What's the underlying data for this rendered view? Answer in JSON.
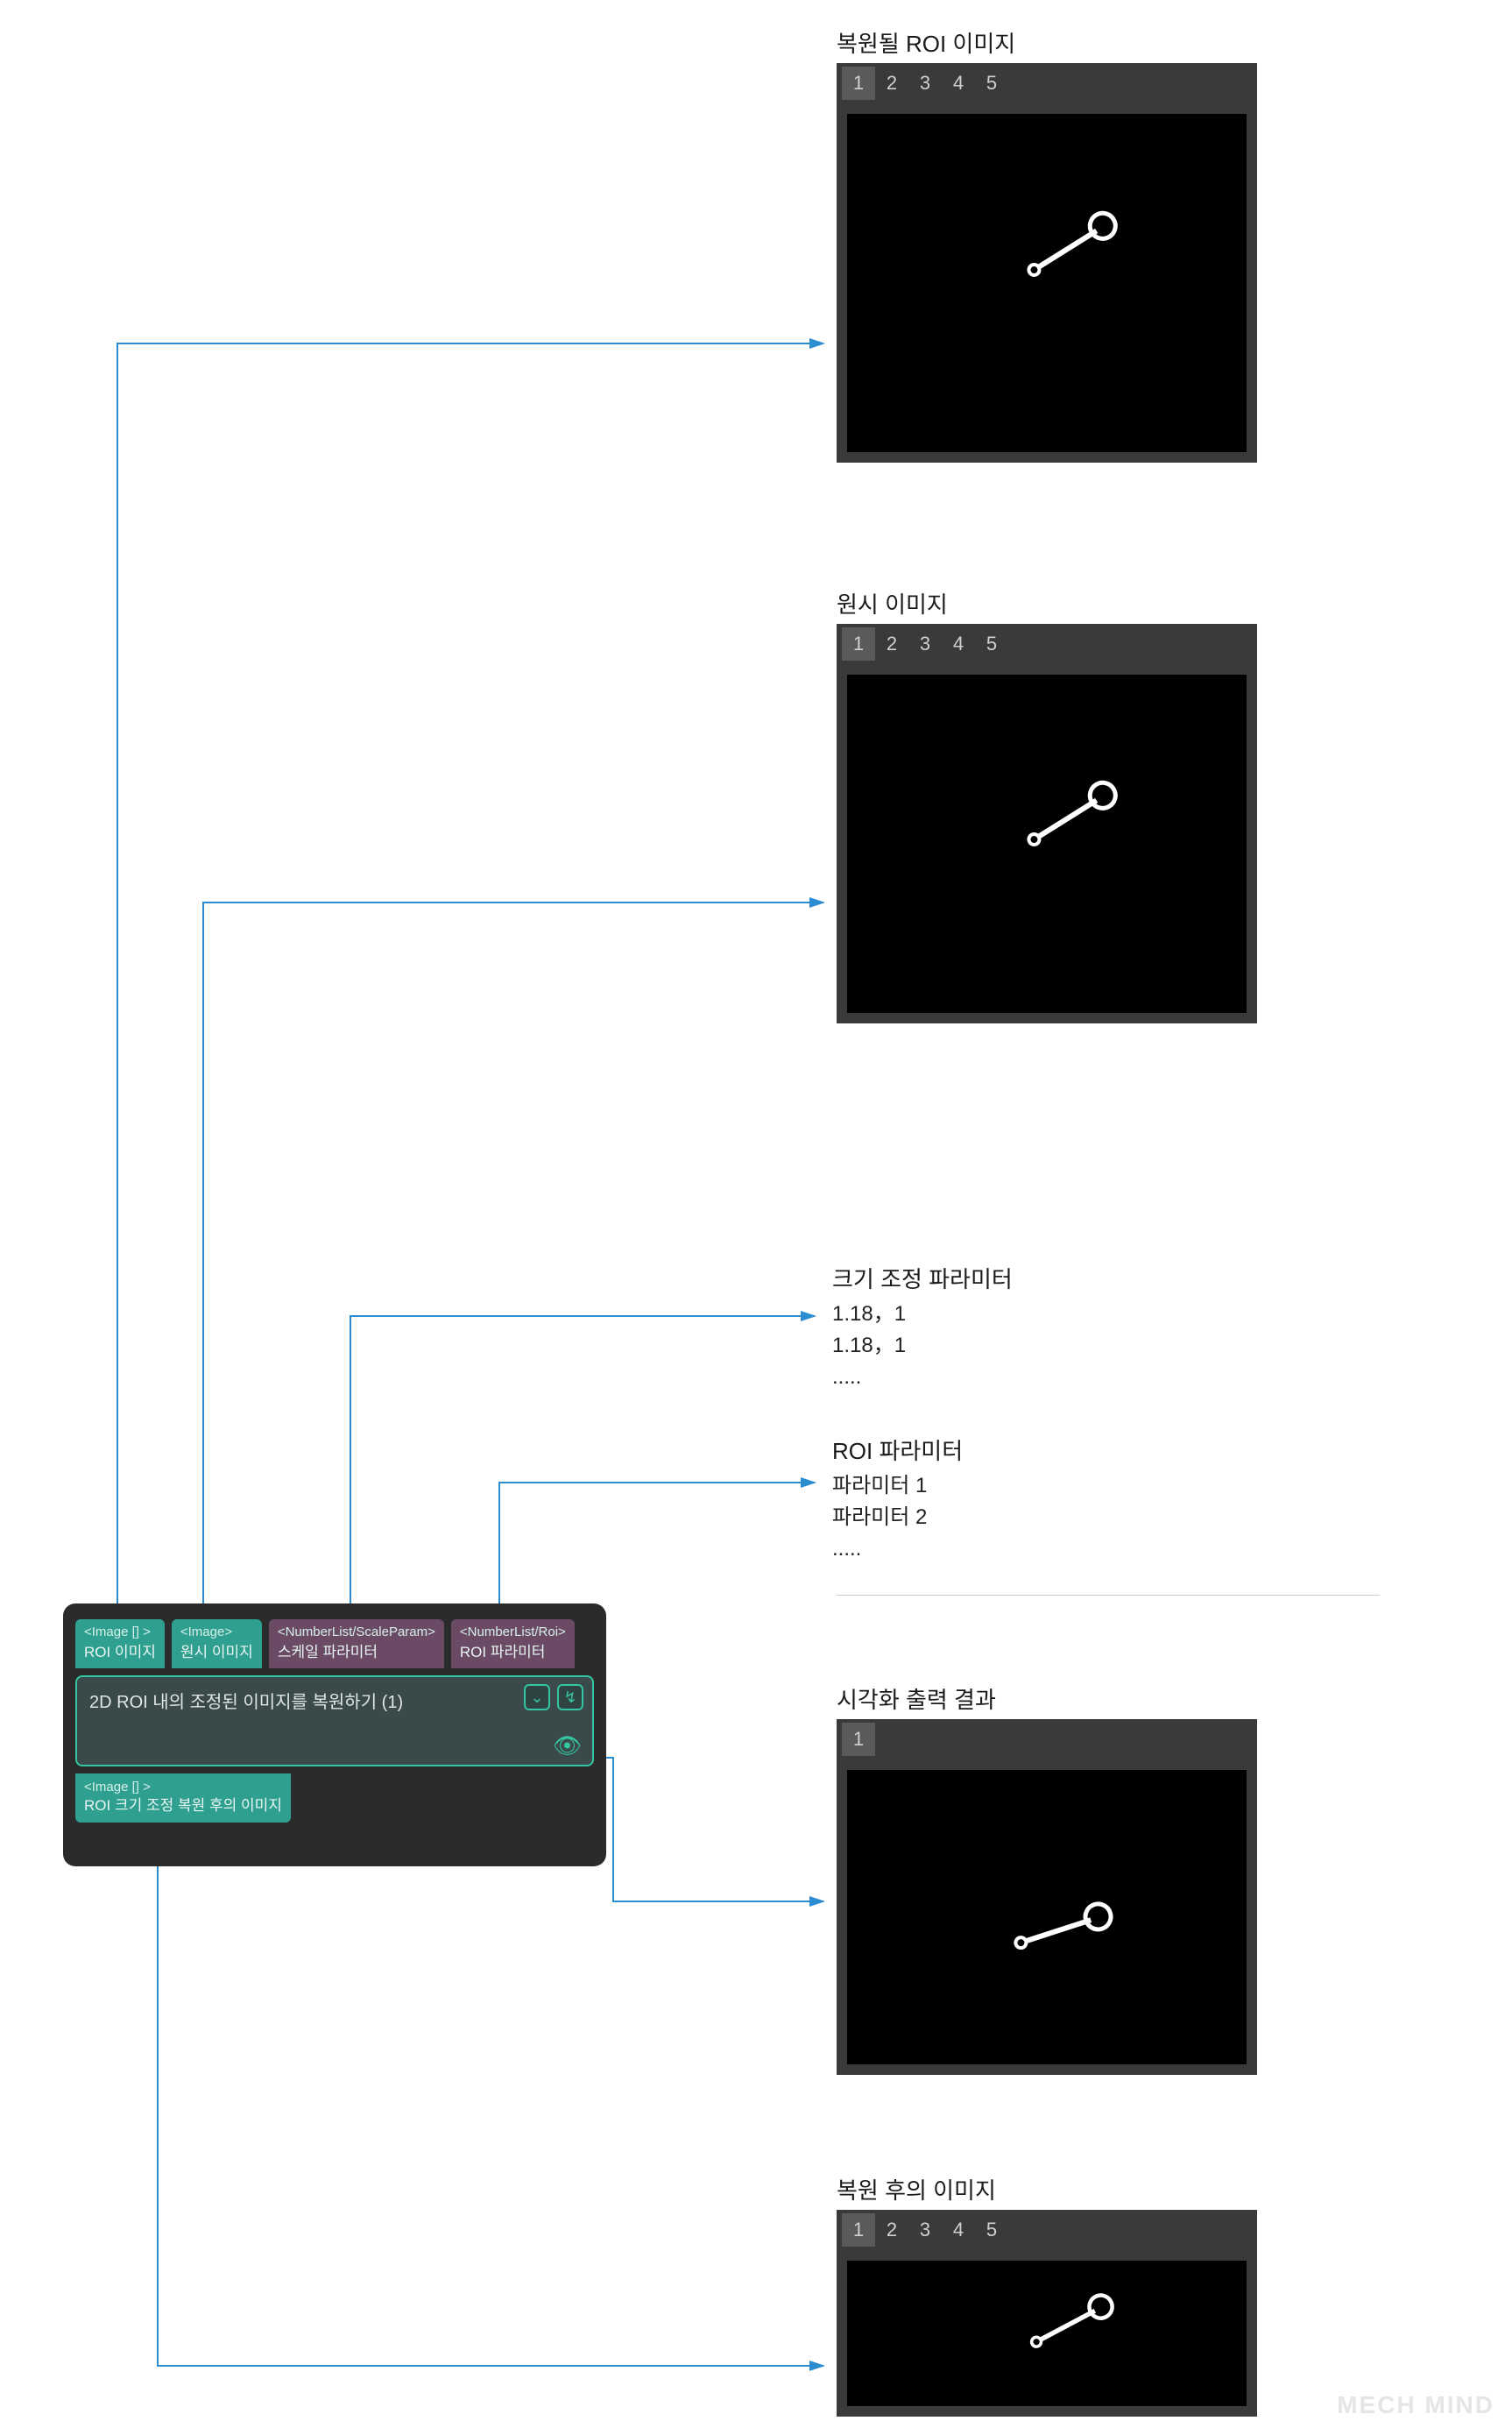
{
  "panels": {
    "roi_restore": {
      "title": "복원될 ROI 이미지",
      "tabs": [
        "1",
        "2",
        "3",
        "4",
        "5"
      ],
      "active_tab": 0
    },
    "raw_image": {
      "title": "원시 이미지",
      "tabs": [
        "1",
        "2",
        "3",
        "4",
        "5"
      ],
      "active_tab": 0
    },
    "scale_params": {
      "title": "크기 조정 파라미터",
      "lines": [
        "1.18，1",
        "1.18，1",
        "....."
      ]
    },
    "roi_params": {
      "title": "ROI 파라미터",
      "lines": [
        "파라미터 1",
        "파라미터 2",
        "....."
      ]
    },
    "viz_output": {
      "title": "시각화 출력 결과",
      "tabs": [
        "1"
      ],
      "active_tab": 0
    },
    "restored_image": {
      "title": "복원 후의 이미지",
      "tabs": [
        "1",
        "2",
        "3",
        "4",
        "5"
      ],
      "active_tab": 0
    }
  },
  "node": {
    "inputs": [
      {
        "type": "<Image [] >",
        "label": "ROI 이미지",
        "style": "teal"
      },
      {
        "type": "<Image>",
        "label": "원시 이미지",
        "style": "teal"
      },
      {
        "type": "<NumberList/ScaleParam>",
        "label": "스케일 파라미터",
        "style": "purple"
      },
      {
        "type": "<NumberList/Roi>",
        "label": "ROI 파라미터",
        "style": "purple"
      }
    ],
    "title": "2D ROI 내의 조정된 이미지를 복원하기 (1)",
    "outputs": [
      {
        "type": "<Image [] >",
        "label": "ROI 크기 조정 복원 후의 이미지"
      }
    ]
  },
  "watermark": "MECH MIND"
}
